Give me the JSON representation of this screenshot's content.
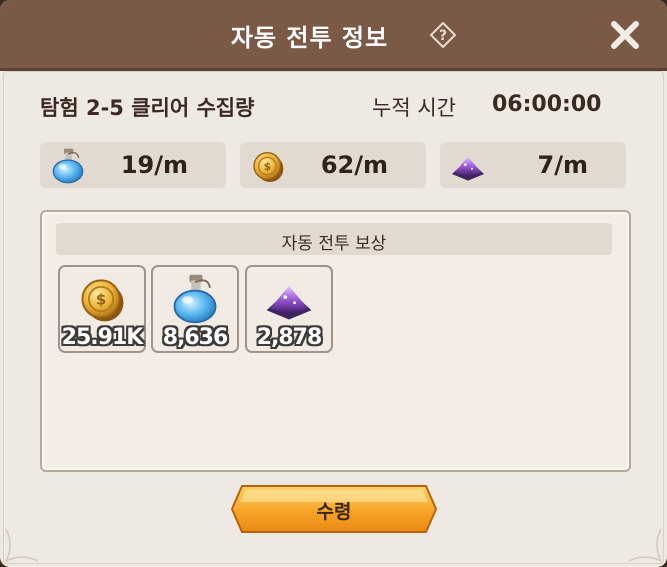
{
  "window": {
    "title": "자동 전투 정보",
    "help_icon": "question-diamond-icon",
    "close_icon": "close-x-icon"
  },
  "info": {
    "stage_label": "탐험 2-5 클리어 수집량",
    "time_label": "누적 시간",
    "time_value": "06:00:00"
  },
  "rates": [
    {
      "icon": "blue-potion-icon",
      "value": "19/m"
    },
    {
      "icon": "gold-coin-icon",
      "value": "62/m"
    },
    {
      "icon": "purple-dust-icon",
      "value": "7/m"
    }
  ],
  "rewards": {
    "title": "자동 전투 보상",
    "items": [
      {
        "icon": "gold-coin-icon",
        "count": "25.91K"
      },
      {
        "icon": "blue-potion-icon",
        "count": "8,636"
      },
      {
        "icon": "purple-dust-icon",
        "count": "2,878"
      }
    ]
  },
  "actions": {
    "claim_label": "수령"
  },
  "colors": {
    "header": "#7a5a47",
    "panel": "#efe9e3",
    "button": "#f5a623"
  }
}
